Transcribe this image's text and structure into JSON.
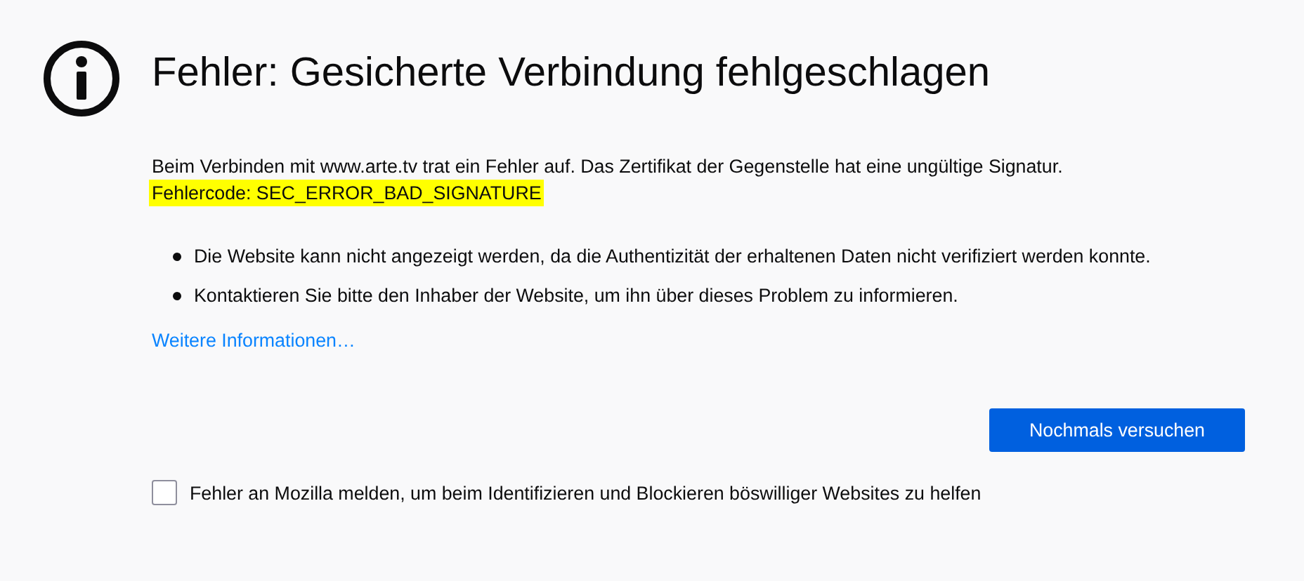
{
  "title": "Fehler: Gesicherte Verbindung fehlgeschlagen",
  "message": "Beim Verbinden mit www.arte.tv trat ein Fehler auf. Das Zertifikat der Gegenstelle hat eine ungültige Signatur.",
  "error_code": {
    "text": "Fehlercode: SEC_ERROR_BAD_SIGNATURE",
    "highlighted": true
  },
  "bullets": [
    "Die Website kann nicht angezeigt werden, da die Authentizität der erhaltenen Daten nicht verifiziert werden konnte.",
    "Kontaktieren Sie bitte den Inhaber der Website, um ihn über dieses Problem zu informieren."
  ],
  "link": "Weitere Informationen…",
  "button": "Nochmals versuchen",
  "report": {
    "label": "Fehler an Mozilla melden, um beim Identifizieren und Blockieren böswilliger Websites zu helfen",
    "checked": false
  }
}
